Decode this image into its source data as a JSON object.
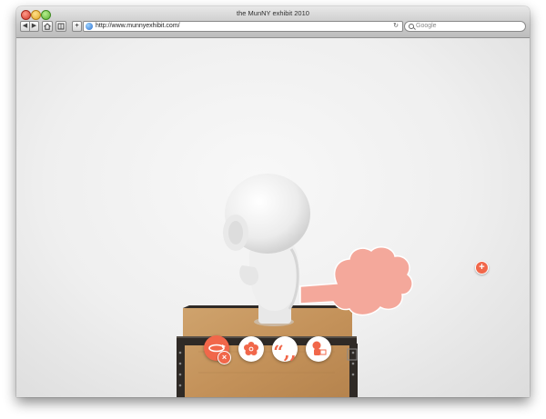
{
  "window": {
    "title": "the MunNY exhibit 2010"
  },
  "toolbar": {
    "back_glyph": "◀",
    "forward_glyph": "▶",
    "add_glyph": "+",
    "reload_glyph": "↻"
  },
  "address_bar": {
    "url": "http://www.munnyexhibit.com/"
  },
  "search": {
    "placeholder": "Google"
  },
  "overlay": {
    "quote_glyph": "“,,",
    "close_glyph": "×",
    "add_glyph": "+"
  },
  "colors": {
    "accent": "#f1674a",
    "cloud": "#f4a89b",
    "crate_wood": "#c79a63",
    "crate_edge": "#2f2a26",
    "figure": "#f0f0f0"
  },
  "icons": {
    "rotate": "rotate-icon",
    "flower": "flower-icon",
    "quote": "quote-icon",
    "figure": "figure-info-icon"
  }
}
